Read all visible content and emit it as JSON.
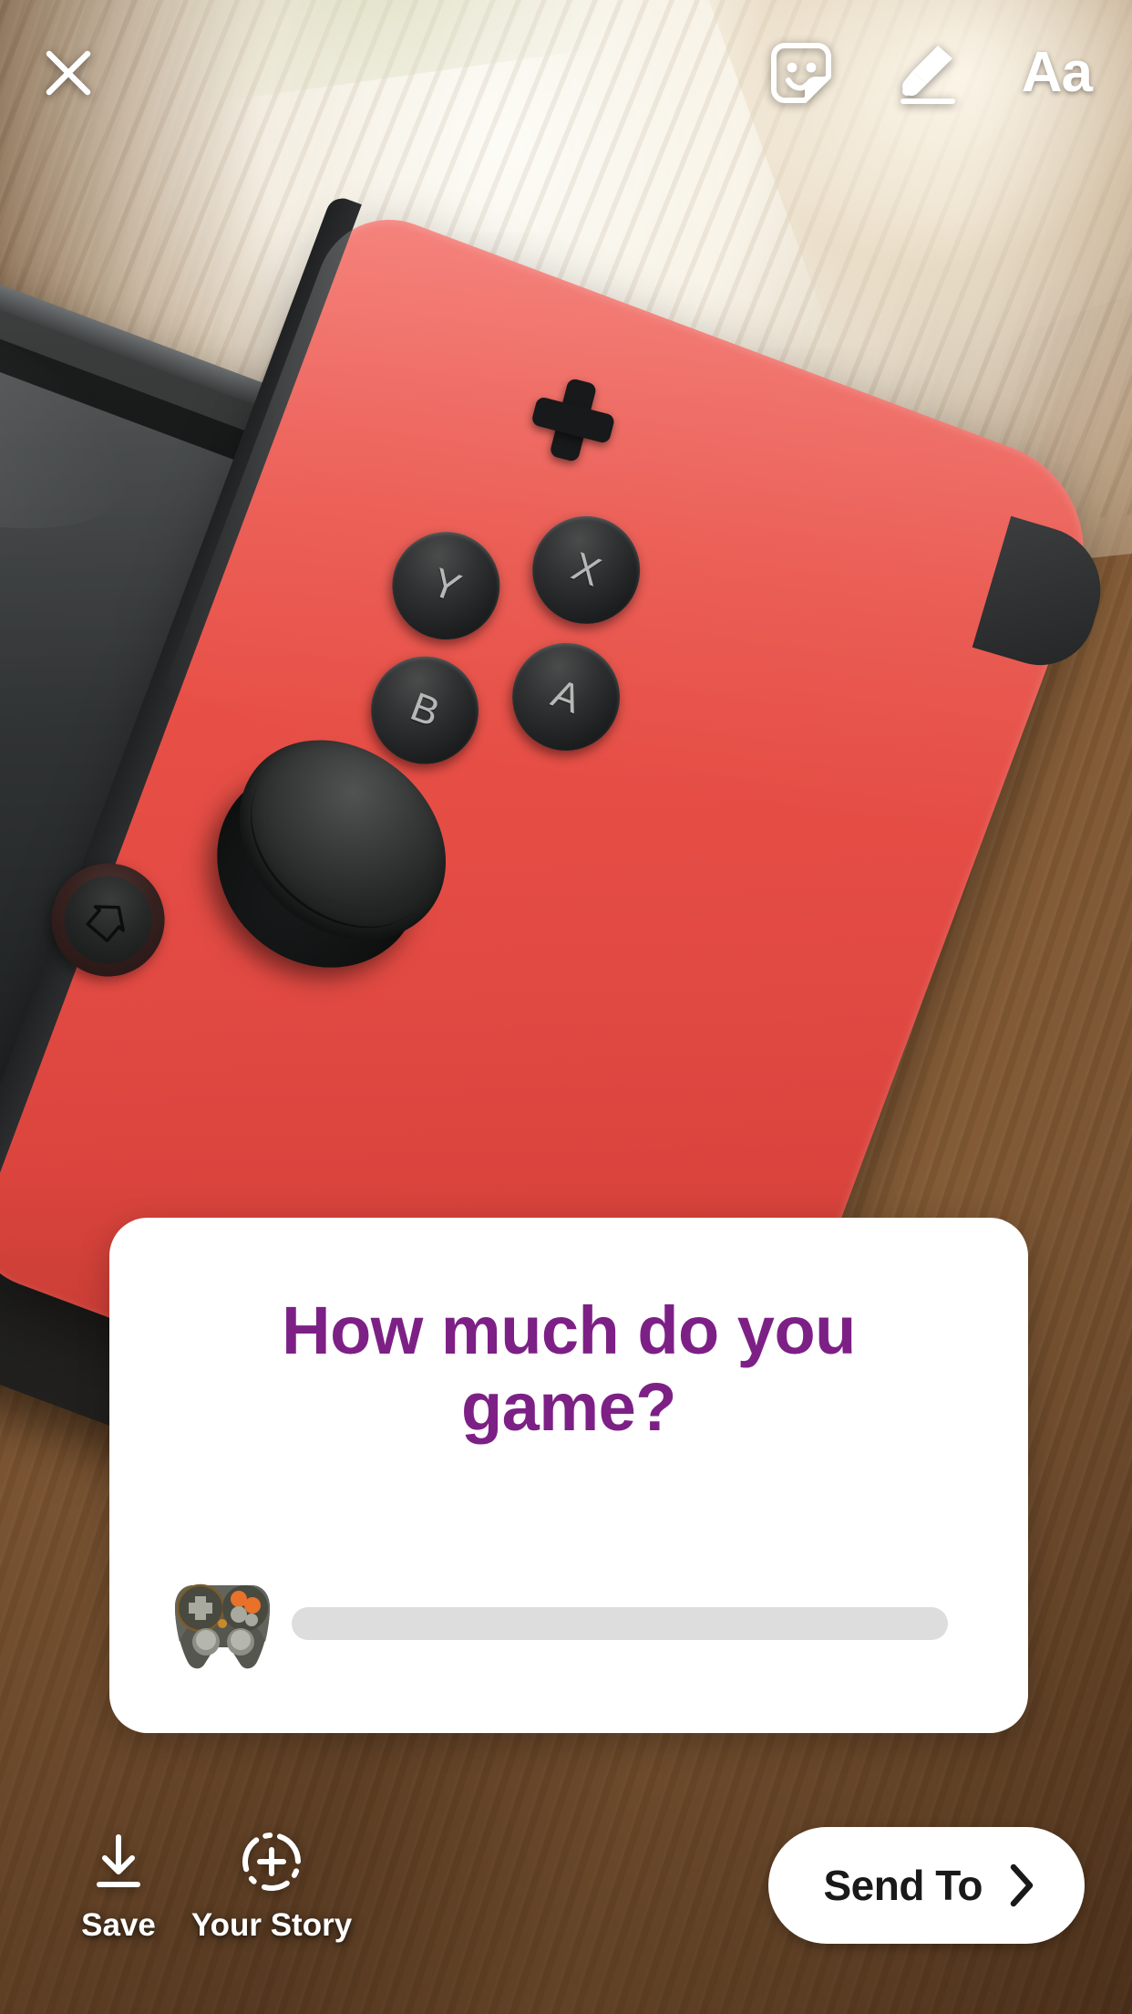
{
  "app": {
    "name": "Instagram Story Editor",
    "screen": "story-composer"
  },
  "topbar": {
    "close_label": "Close",
    "close_icon": "close-x-icon",
    "actions": [
      {
        "id": "sticker",
        "label": "Stickers",
        "icon": "sticker-smiley-icon"
      },
      {
        "id": "draw",
        "label": "Draw",
        "icon": "marker-pen-icon"
      },
      {
        "id": "text",
        "label": "Aa",
        "icon": "text-aa-icon"
      }
    ]
  },
  "sticker": {
    "type": "emoji-slider",
    "question": "How much do you game?",
    "question_color": "#7d2086",
    "card_background": "#ffffff",
    "emoji": "🎮",
    "emoji_name": "video-game-controller-emoji",
    "slider_value": 0,
    "slider_track_color": "#dddddd"
  },
  "bottombar": {
    "actions": [
      {
        "id": "save",
        "label": "Save",
        "icon": "download-arrow-icon"
      },
      {
        "id": "your-story",
        "label": "Your Story",
        "icon": "add-to-story-plus-icon"
      }
    ],
    "send_to": {
      "label": "Send To",
      "icon": "chevron-right-icon",
      "background": "#ffffff",
      "text_color": "#19191a"
    }
  },
  "photo": {
    "subject": "Nintendo Switch console with red Joy-Con on a wooden table",
    "joycon_color": "#e74f46",
    "table_color": "#7e5632",
    "buttons": [
      "X",
      "Y",
      "A",
      "B"
    ]
  }
}
